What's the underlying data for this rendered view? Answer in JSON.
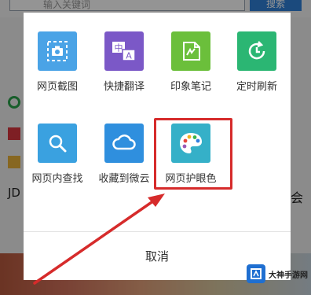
{
  "background": {
    "search_placeholder": "输入关键词",
    "search_button": "搜索",
    "right_partial_text": "会",
    "left_partial_text": "JD"
  },
  "dialog": {
    "items": [
      {
        "label": "网页截图",
        "icon": "camera-screenshot-icon",
        "color": "#4aa3e6"
      },
      {
        "label": "快捷翻译",
        "icon": "translate-icon",
        "color": "#7b58c7"
      },
      {
        "label": "印象笔记",
        "icon": "evernote-icon",
        "color": "#6bbf3b"
      },
      {
        "label": "定时刷新",
        "icon": "timer-refresh-icon",
        "color": "#2bb673"
      },
      {
        "label": "网页内查找",
        "icon": "search-in-page-icon",
        "color": "#3aa1e0"
      },
      {
        "label": "收藏到微云",
        "icon": "weiyun-cloud-icon",
        "color": "#2f8fde"
      },
      {
        "label": "网页护眼色",
        "icon": "palette-eye-care-icon",
        "color": "#35b0c8"
      }
    ],
    "cancel_label": "取消",
    "highlight_color": "#d62b2b"
  },
  "watermark": {
    "text": "大神手游网"
  }
}
